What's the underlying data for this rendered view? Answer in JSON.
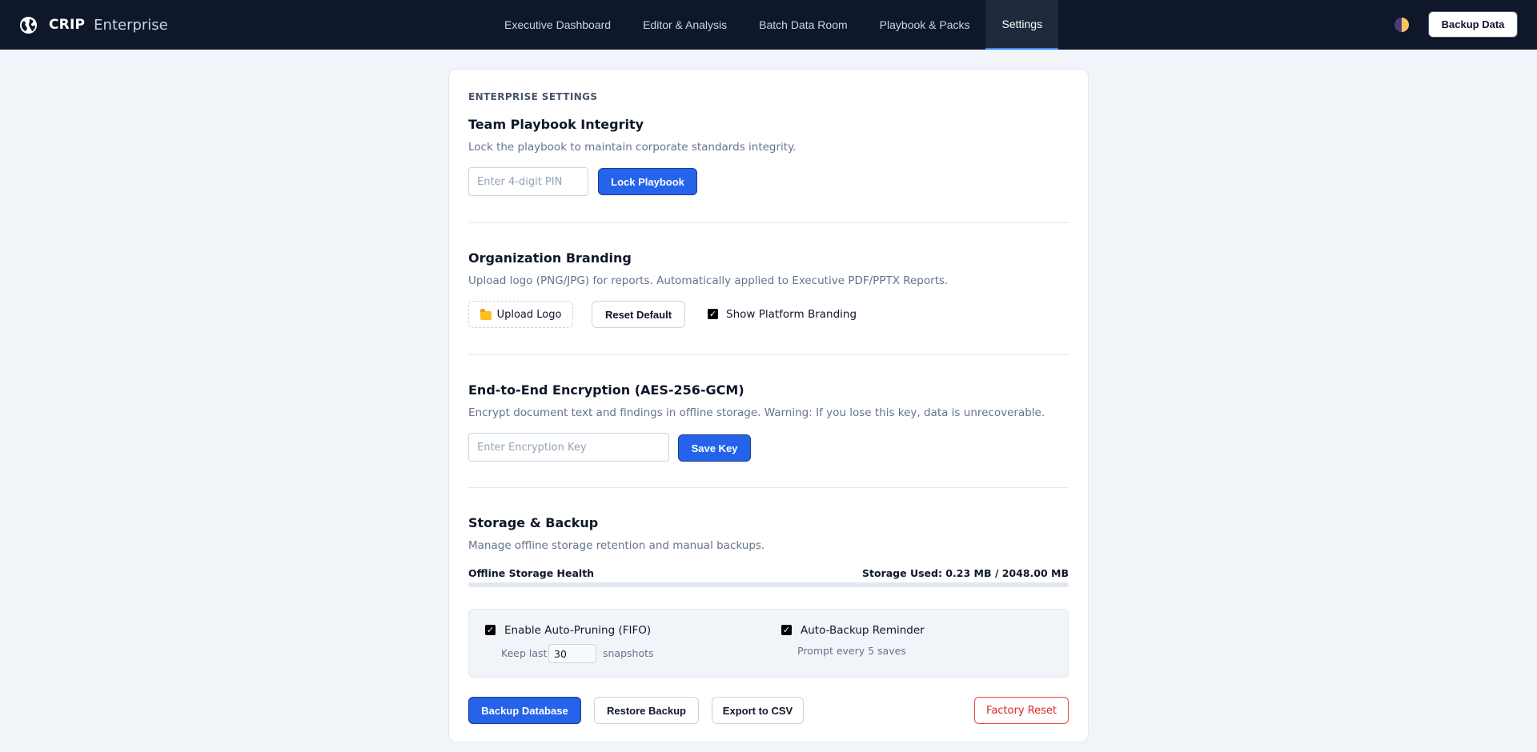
{
  "header": {
    "brand_name": "CRIP",
    "brand_sub": "Enterprise",
    "brand_icon": "globe-icon",
    "nav": [
      {
        "label": "Executive Dashboard",
        "active": false
      },
      {
        "label": "Editor & Analysis",
        "active": false
      },
      {
        "label": "Batch Data Room",
        "active": false
      },
      {
        "label": "Playbook & Packs",
        "active": false
      },
      {
        "label": "Settings",
        "active": true
      }
    ],
    "theme_icon": "theme-toggle-icon",
    "backup_label": "Backup Data"
  },
  "settings": {
    "eyebrow": "ENTERPRISE SETTINGS",
    "playbook": {
      "title": "Team Playbook Integrity",
      "description": "Lock the playbook to maintain corporate standards integrity.",
      "pin_placeholder": "Enter 4-digit PIN",
      "lock_label": "Lock Playbook"
    },
    "branding": {
      "title": "Organization Branding",
      "description": "Upload logo (PNG/JPG) for reports. Automatically applied to Executive PDF/PPTX Reports.",
      "upload_label": "Upload Logo",
      "reset_label": "Reset Default",
      "show_branding_label": "Show Platform Branding",
      "show_branding_checked": true
    },
    "encryption": {
      "title": "End-to-End Encryption (AES-256-GCM)",
      "description": "Encrypt document text and findings in offline storage. Warning: If you lose this key, data is unrecoverable.",
      "key_placeholder": "Enter Encryption Key",
      "save_label": "Save Key"
    },
    "storage": {
      "title": "Storage & Backup",
      "description": "Manage offline storage retention and manual backups.",
      "health_label": "Offline Storage Health",
      "used_label": "Storage Used: 0.23 MB / 2048.00 MB",
      "used_fraction": 0.0001,
      "auto_pruning_label": "Enable Auto-Pruning (FIFO)",
      "auto_pruning_checked": true,
      "keep_last_label": "Keep last",
      "keep_last_value": "30",
      "snapshots_label": "snapshots",
      "auto_backup_label": "Auto-Backup Reminder",
      "auto_backup_checked": true,
      "prompt_label": "Prompt every 5 saves",
      "backup_db_label": "Backup Database",
      "restore_label": "Restore Backup",
      "export_label": "Export to CSV",
      "factory_reset_label": "Factory Reset"
    }
  },
  "colors": {
    "nav_bg": "#0f172a",
    "primary": "#2563eb",
    "danger": "#dc2626",
    "page_bg": "#f1f5f9"
  }
}
